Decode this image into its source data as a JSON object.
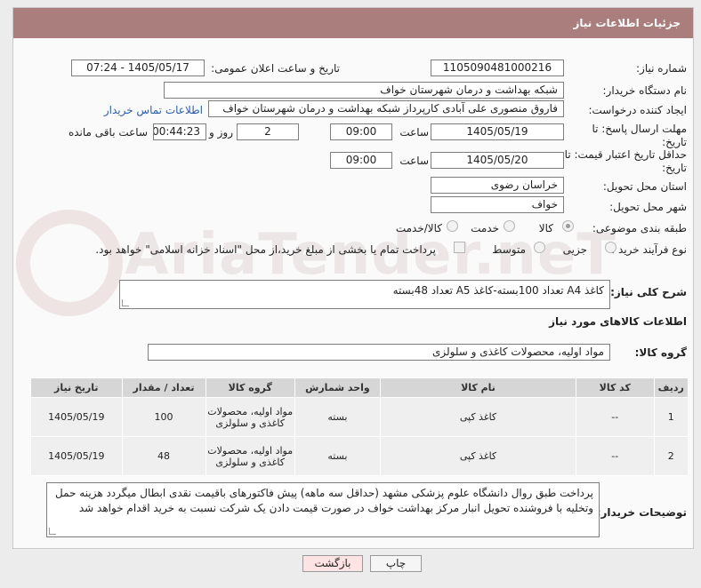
{
  "header": {
    "title": "جزئیات اطلاعات نیاز"
  },
  "fields": {
    "need_number_label": "شماره نیاز:",
    "need_number": "1105090481000216",
    "announce_label": "تاریخ و ساعت اعلان عمومی:",
    "announce_value": "1405/05/17 - 07:24",
    "buyer_org_label": "نام دستگاه خریدار:",
    "buyer_org": "شبکه بهداشت و درمان شهرستان خواف",
    "creator_label": "ایجاد کننده درخواست:",
    "creator": "فاروق منصوری علی آبادی کارپرداز شبکه بهداشت و درمان شهرستان خواف",
    "contact_link": "اطلاعات تماس خریدار",
    "reply_deadline_label": "مهلت ارسال پاسخ: تا تاریخ:",
    "reply_date": "1405/05/19",
    "time_label": "ساعت",
    "reply_time": "09:00",
    "days_value": "2",
    "days_label": "روز و",
    "remaining_time": "00:44:23",
    "remaining_label": "ساعت باقی مانده",
    "price_validity_label": "حداقل تاریخ اعتبار قیمت: تا تاریخ:",
    "price_date": "1405/05/20",
    "price_time": "09:00",
    "province_label": "استان محل تحویل:",
    "province": "خراسان رضوی",
    "city_label": "شهر محل تحویل:",
    "city": "خواف",
    "category_label": "طبقه بندی موضوعی:",
    "category_options": [
      "کالا",
      "خدمت",
      "کالا/خدمت"
    ],
    "process_label": "نوع فرآیند خرید :",
    "process_options": [
      "جزیی",
      "متوسط"
    ],
    "payment_note": "پرداخت تمام یا بخشی از مبلغ خرید،از محل \"اسناد خزانه اسلامی\" خواهد بود.",
    "description_label": "شرح کلی نیاز:",
    "description": "کاغذ A4 تعداد 100بسته-کاغذ A5 تعداد 48بسته",
    "goods_info_title": "اطلاعات کالاهای مورد نیاز",
    "goods_group_label": "گروه کالا:",
    "goods_group": "مواد اولیه، محصولات کاغذی و سلولزی"
  },
  "table": {
    "headers": [
      "ردیف",
      "کد کالا",
      "نام کالا",
      "واحد شمارش",
      "گروه کالا",
      "تعداد / مقدار",
      "تاریخ نیاز"
    ],
    "rows": [
      [
        "1",
        "--",
        "کاغذ کپی",
        "بسته",
        "مواد اولیه، محصولات کاغذی و سلولزی",
        "100",
        "1405/05/19"
      ],
      [
        "2",
        "--",
        "کاغذ کپی",
        "بسته",
        "مواد اولیه، محصولات کاغذی و سلولزی",
        "48",
        "1405/05/19"
      ]
    ]
  },
  "buyer_notes_label": "توضیحات خریدار:",
  "buyer_notes": "پرداخت طبق روال دانشگاه علوم پزشکی مشهد (حداقل سه ماهه) پیش فاکتورهای باقیمت نقدی ابطال میگردد هزینه حمل وتخلیه  با فروشنده تحویل انبار مرکز بهداشت خواف در صورت قیمت دادن یک شرکت نسبت به خرید اقدام خواهد شد",
  "buttons": {
    "print": "چاپ",
    "back": "بازگشت"
  },
  "watermark": "AriaTender.neT",
  "colors": {
    "header_bg": "#ab7e7e",
    "link": "#2a5db0",
    "back_button_bg": "#fde3e3"
  }
}
